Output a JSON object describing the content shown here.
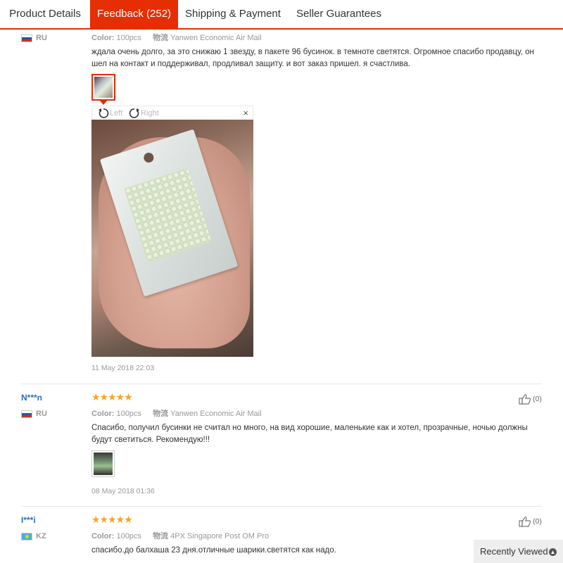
{
  "tabs": [
    {
      "label": "Product Details"
    },
    {
      "label": "Feedback (252)"
    },
    {
      "label": "Shipping & Payment"
    },
    {
      "label": "Seller Guarantees"
    }
  ],
  "meta_labels": {
    "color": "Color:",
    "logistics": "物流"
  },
  "feedback": [
    {
      "country": "RU",
      "color": "100pcs",
      "shipping": "Yanwen Economic Air Mail",
      "text": "ждала очень долго, за это снижаю 1 звезду, в пакете 96 бусинок. в темноте светятся. Огромное спасибо продавцу, он шел на контакт и поддерживал, продливал защиту. и вот заказ пришел. я счастлива.",
      "date": "11 May 2018 22:03",
      "viewer": {
        "left": "Left",
        "right": "Right",
        "close": "×"
      }
    },
    {
      "user": "N***n",
      "country": "RU",
      "stars": "★★★★★",
      "color": "100pcs",
      "shipping": "Yanwen Economic Air Mail",
      "text": "Спасибо, получил бусинки не считал но много, на вид хорошие, маленькие как и хотел, прозрачные, ночью должны будут светиться. Рекомендую!!!",
      "date": "08 May 2018 01:36",
      "helpful": "(0)"
    },
    {
      "user": "I***i",
      "country": "KZ",
      "stars": "★★★★★",
      "color": "100pcs",
      "shipping": "4PX Singapore Post OM Pro",
      "text": "спасибо.до балхаша 23 дня.отличные шарики.светятся как надо.",
      "helpful": "(0)"
    }
  ],
  "recently_viewed": {
    "label": "Recently Viewed",
    "icon": "chevron-up-icon"
  }
}
